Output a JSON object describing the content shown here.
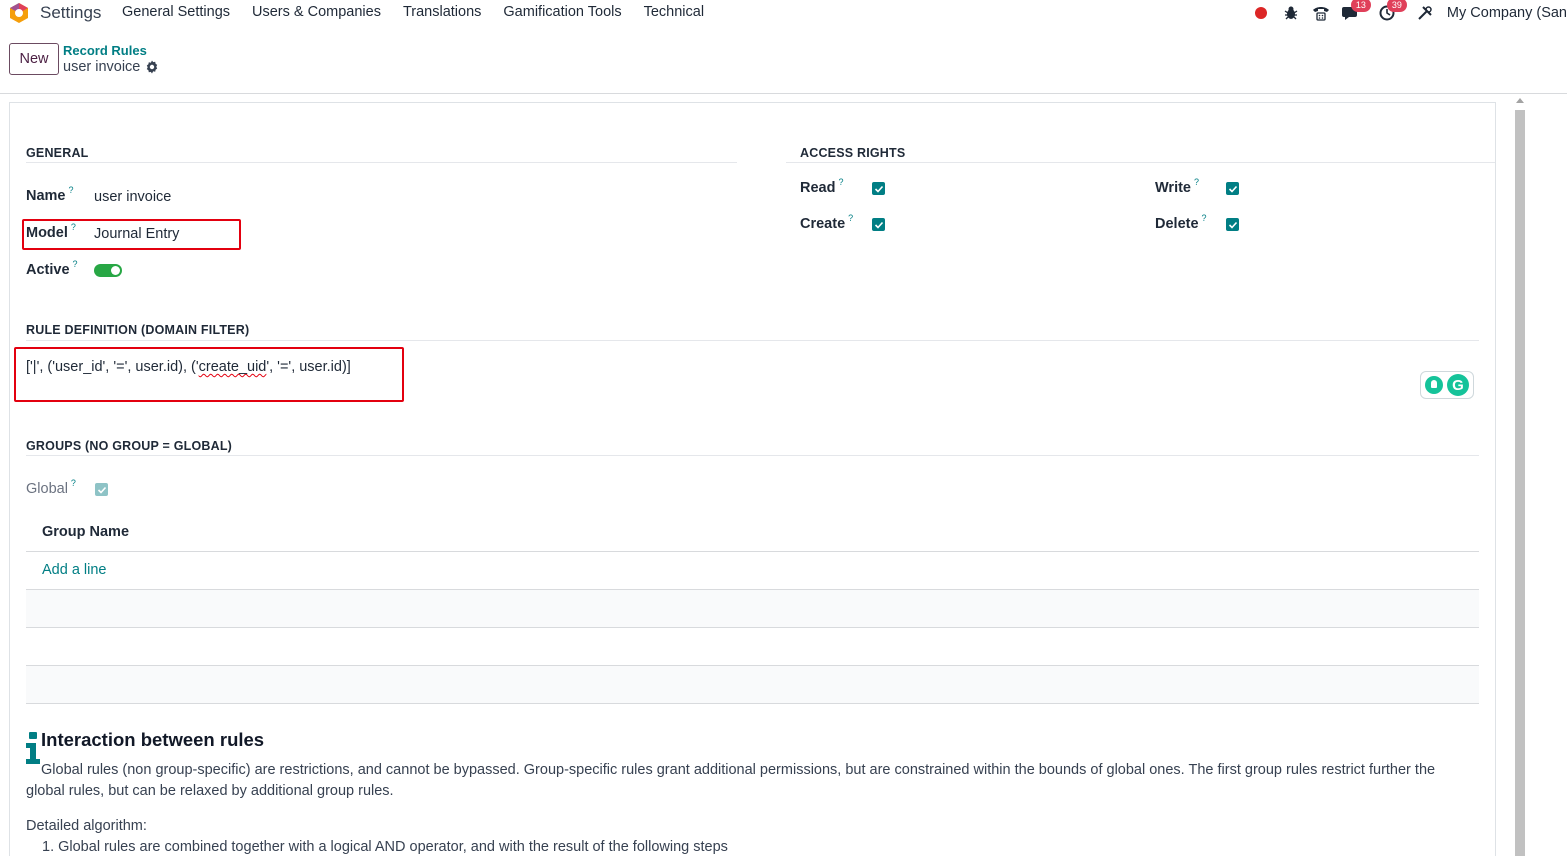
{
  "app": {
    "name": "Settings",
    "menu": [
      "General Settings",
      "Users & Companies",
      "Translations",
      "Gamification Tools",
      "Technical"
    ]
  },
  "systray": {
    "messages_badge": "13",
    "activities_badge": "39",
    "company": "My Company (San"
  },
  "control_panel": {
    "new_label": "New",
    "breadcrumb_parent": "Record Rules",
    "breadcrumb_current": "user invoice"
  },
  "general": {
    "title": "GENERAL",
    "name_label": "Name",
    "name_value": "user invoice",
    "model_label": "Model",
    "model_value": "Journal Entry",
    "active_label": "Active",
    "active": true
  },
  "access_rights": {
    "title": "ACCESS RIGHTS",
    "read_label": "Read",
    "write_label": "Write",
    "create_label": "Create",
    "delete_label": "Delete",
    "read": true,
    "write": true,
    "create": true,
    "delete": true
  },
  "rule_definition": {
    "title": "RULE DEFINITION (DOMAIN FILTER)",
    "domain_part1": "['|', ('user_id', '=', user.id), ('",
    "domain_squiggle": "create_uid",
    "domain_part2": "', '=', user.id)]"
  },
  "groups": {
    "title": "GROUPS (NO GROUP = GLOBAL)",
    "global_label": "Global",
    "global": true,
    "column_header": "Group Name",
    "add_line": "Add a line"
  },
  "help": {
    "title": "Interaction between rules",
    "paragraph": "Global rules (non group-specific) are restrictions, and cannot be bypassed. Group-specific rules grant additional permissions, but are constrained within the bounds of global ones. The first group rules restrict further the global rules, but can be relaxed by additional group rules.",
    "detailed": "Detailed algorithm:",
    "step1": "1. Global rules are combined together with a logical AND operator, and with the result of the following steps"
  },
  "colors": {
    "accent": "#017e84",
    "brand": "#714b67",
    "highlight_box": "#e3000f",
    "toggle_on": "#28a745"
  }
}
